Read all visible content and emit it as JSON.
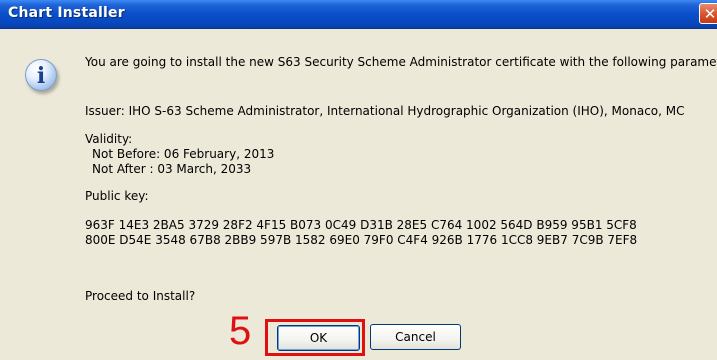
{
  "window": {
    "title": "Chart Installer",
    "close_glyph": "✕"
  },
  "icon": "info-icon",
  "message": {
    "intro": "You are going to install the new S63 Security Scheme Administrator certificate with the following parameters:",
    "issuer": "Issuer:  IHO S-63 Scheme Administrator, International Hydrographic Organization (IHO), Monaco, MC",
    "validity_label": "Validity:",
    "not_before": "Not Before: 06 February, 2013",
    "not_after": "Not After : 03 March, 2033",
    "public_key_label": "Public key:",
    "public_key_line1": "963F 14E3 2BA5 3729 28F2 4F15 B073 0C49 D31B 28E5 C764 1002 564D B959 95B1 5CF8",
    "public_key_line2": "800E D54E 3548 67B8 2BB9 597B 1582 69E0 79F0 C4F4 926B 1776 1CC8 9EB7 7C9B 7EF8",
    "proceed": "Proceed to Install?"
  },
  "buttons": {
    "ok": "OK",
    "cancel": "Cancel"
  },
  "annotation": {
    "step_number": "5",
    "color": "#e01010"
  }
}
